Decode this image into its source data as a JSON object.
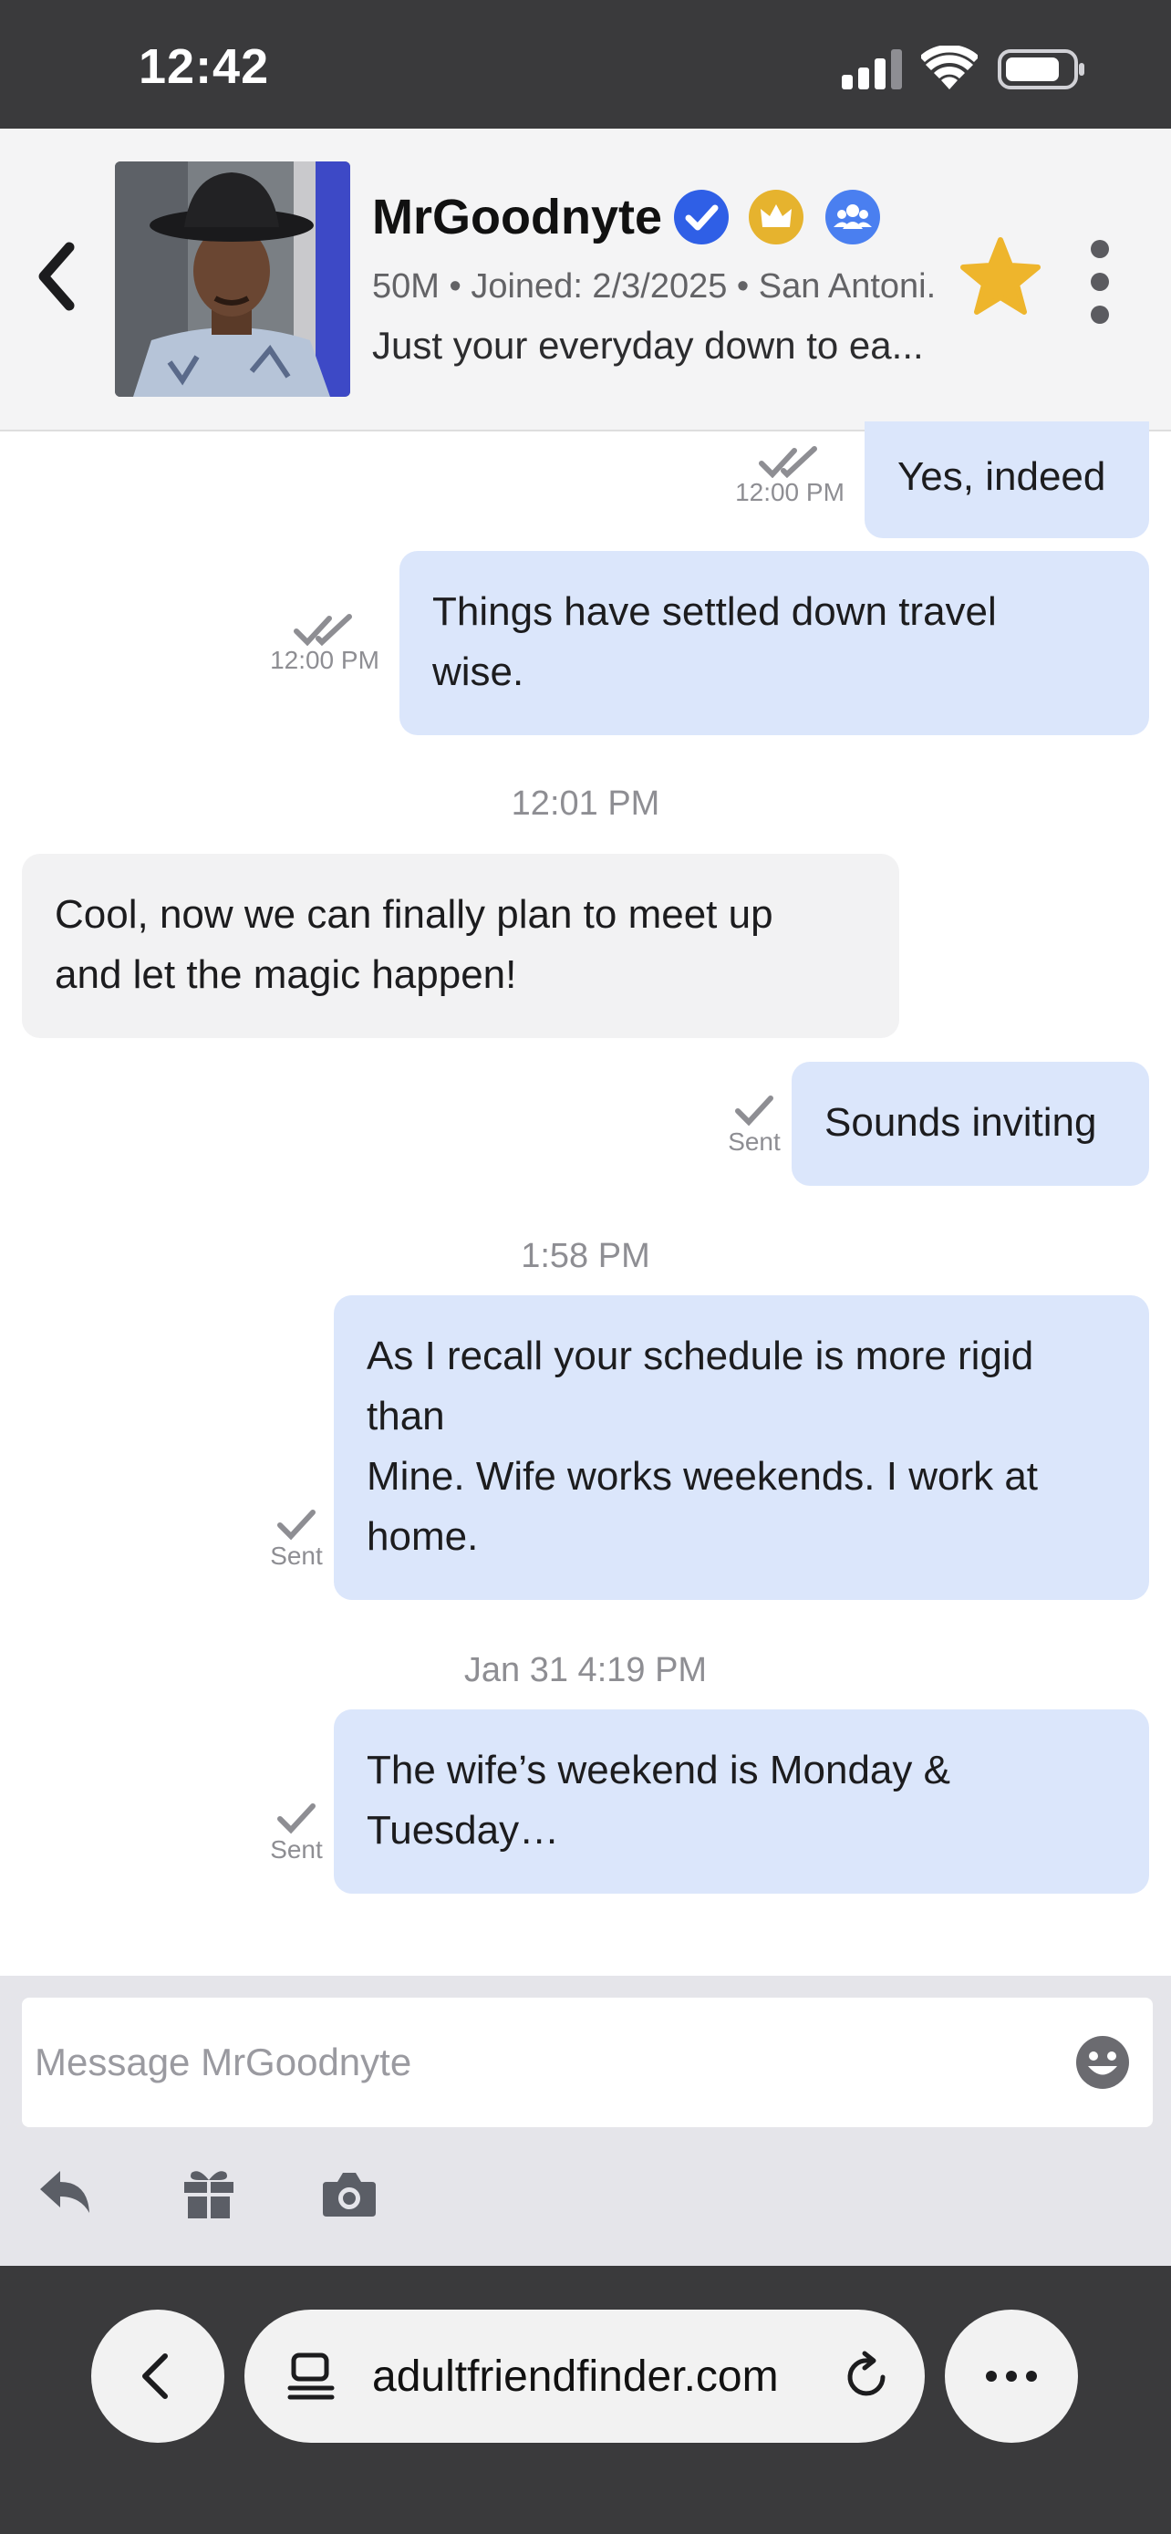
{
  "status_bar": {
    "time": "12:42"
  },
  "header": {
    "name": "MrGoodnyte",
    "meta": "50M • Joined: 2/3/2025 • San Antoni...",
    "tagline": "Just your everyday down to ea..."
  },
  "messages": [
    {
      "text": "Yes, indeed",
      "receipt": "12:00 PM"
    },
    {
      "text": "Things have settled down travel\nwise.",
      "receipt": "12:00 PM"
    },
    {
      "divider": "12:01 PM"
    },
    {
      "text": "Cool, now we can finally plan to meet up\nand let the magic happen!"
    },
    {
      "text": "Sounds inviting",
      "receipt": "Sent"
    },
    {
      "divider": "1:58 PM"
    },
    {
      "text": "As I recall your schedule is more rigid\nthan\nMine. Wife works weekends. I work at\nhome.",
      "receipt": "Sent"
    },
    {
      "divider": "Jan 31 4:19 PM"
    },
    {
      "text": "The wife’s weekend is Monday &\nTuesday…",
      "receipt": "Sent"
    }
  ],
  "composer": {
    "placeholder": "Message MrGoodnyte"
  },
  "browser": {
    "url": "adultfriendfinder.com"
  },
  "icons": {
    "back": "chevron-left-icon",
    "verified": "verified-check-icon",
    "gold": "crown-icon",
    "group": "group-icon",
    "favorite": "star-icon",
    "more": "more-vertical-icon",
    "emoji": "emoji-icon",
    "reply": "reply-icon",
    "gift": "gift-icon",
    "camera": "camera-icon"
  },
  "colors": {
    "outgoing_bubble": "#dbe6fb",
    "incoming_bubble": "#f2f2f3",
    "verified": "#2f5fe6",
    "gold": "#e6b32e",
    "group": "#4a7ff0",
    "star": "#eeb52c"
  }
}
